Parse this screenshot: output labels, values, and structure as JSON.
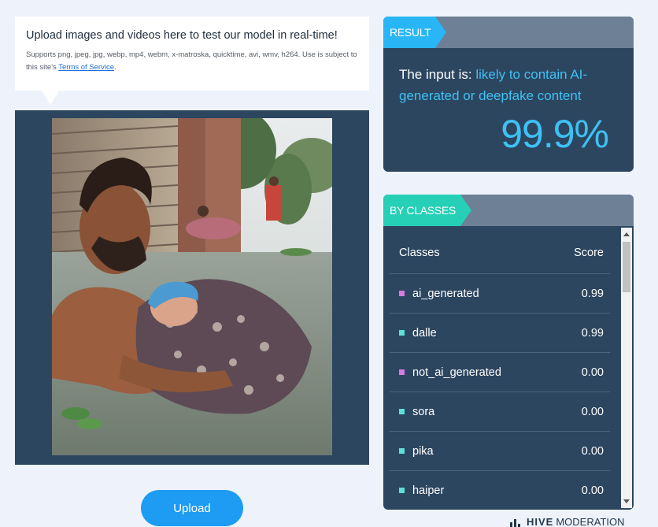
{
  "upload_info": {
    "title": "Upload images and videos here to test our model in real-time!",
    "support_text": "Supports png, jpeg, jpg, webp, mp4, webm, x-matroska, quicktime, avi, wmv, h264. Use is subject to this site's ",
    "terms_link": "Terms of Service",
    "trailing": "."
  },
  "upload_button": {
    "label": "Upload"
  },
  "result": {
    "tag": "RESULT",
    "prefix": "The input is: ",
    "verdict": "likely to contain AI-generated or deepfake content",
    "score": "99.9%",
    "accent_color": "#3ec1f5"
  },
  "classes": {
    "tag": "BY CLASSES",
    "header_class": "Classes",
    "header_score": "Score",
    "rows": [
      {
        "name": "ai_generated",
        "score": "0.99",
        "color": "#d77be0"
      },
      {
        "name": "dalle",
        "score": "0.99",
        "color": "#5fe0d6"
      },
      {
        "name": "not_ai_generated",
        "score": "0.00",
        "color": "#d77be0"
      },
      {
        "name": "sora",
        "score": "0.00",
        "color": "#5fe0d6"
      },
      {
        "name": "pika",
        "score": "0.00",
        "color": "#5fe0d6"
      },
      {
        "name": "haiper",
        "score": "0.00",
        "color": "#5fe0d6"
      }
    ]
  },
  "brand": {
    "name": "HIVE",
    "suffix": "MODERATION"
  }
}
